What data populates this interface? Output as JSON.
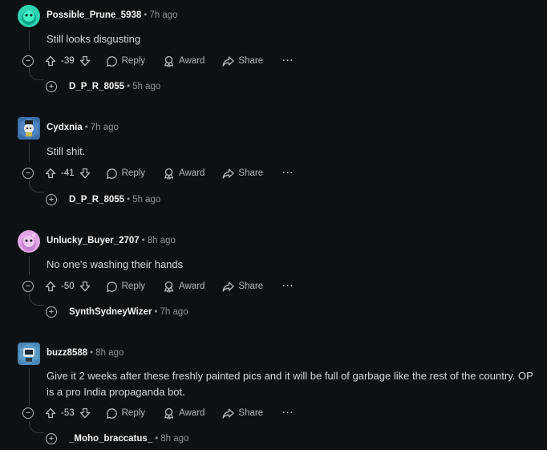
{
  "comments": [
    {
      "author": "Possible_Prune_5938",
      "time": "7h ago",
      "text": "Still looks disgusting",
      "score": "-39",
      "reply_label": "Reply",
      "award_label": "Award",
      "share_label": "Share",
      "more_label": "···",
      "avatar_color": "#2fd3b0",
      "child": {
        "author": "D_P_R_8055",
        "time": "5h ago"
      }
    },
    {
      "author": "Cydxnia",
      "time": "7h ago",
      "text": "Still shit.",
      "score": "-41",
      "reply_label": "Reply",
      "award_label": "Award",
      "share_label": "Share",
      "more_label": "···",
      "avatar_color": "#3a6fa8",
      "child": {
        "author": "D_P_R_8055",
        "time": "5h ago"
      }
    },
    {
      "author": "Unlucky_Buyer_2707",
      "time": "8h ago",
      "text": "No one's washing their hands",
      "score": "-50",
      "reply_label": "Reply",
      "award_label": "Award",
      "share_label": "Share",
      "more_label": "···",
      "avatar_color": "#e2a6e8",
      "child": {
        "author": "SynthSydneyWizer",
        "time": "7h ago"
      }
    },
    {
      "author": "buzz8588",
      "time": "8h ago",
      "text": "Give it 2 weeks after these freshly painted pics and it will be full of garbage like the rest of the country. OP is a pro India propaganda bot.",
      "score": "-53",
      "reply_label": "Reply",
      "award_label": "Award",
      "share_label": "Share",
      "more_label": "···",
      "avatar_color": "#4b86b4",
      "child": {
        "author": "_Moho_braccatus_",
        "time": "8h ago"
      }
    }
  ],
  "separator": "•",
  "collapse_symbol": "−",
  "expand_symbol": "+"
}
